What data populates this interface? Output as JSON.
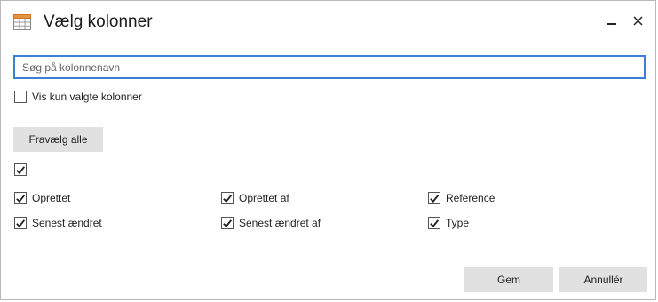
{
  "dialog": {
    "title": "Vælg kolonner",
    "title_icon": "table-grid-icon",
    "minimize_icon": "minimize-icon",
    "close_icon": "close-icon"
  },
  "search": {
    "placeholder": "Søg på kolonnenavn",
    "value": ""
  },
  "show_selected_only": {
    "label": "Vis kun valgte kolonner",
    "checked": false
  },
  "deselect_all_label": "Fravælg alle",
  "select_all": {
    "checked": true
  },
  "columns": [
    {
      "label": "Oprettet",
      "checked": true
    },
    {
      "label": "Oprettet af",
      "checked": true
    },
    {
      "label": "Reference",
      "checked": true
    },
    {
      "label": "Senest ændret",
      "checked": true
    },
    {
      "label": "Senest ændret af",
      "checked": true
    },
    {
      "label": "Type",
      "checked": true
    }
  ],
  "footer": {
    "save_label": "Gem",
    "cancel_label": "Annullér"
  },
  "colors": {
    "accent": "#3c7fd6",
    "button_bg": "#e1e1e1",
    "icon_orange": "#e8923a"
  }
}
